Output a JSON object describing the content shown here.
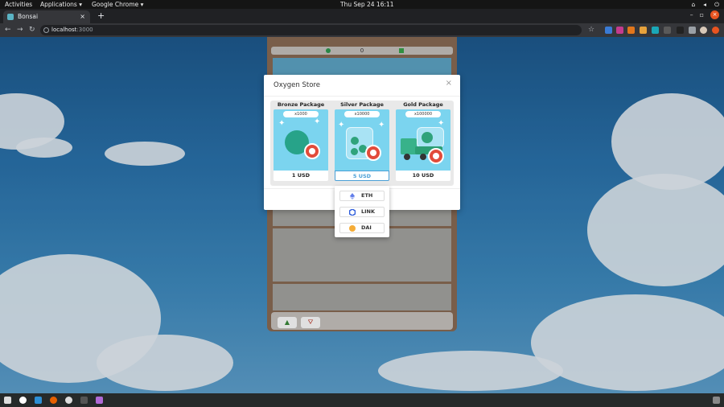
{
  "gnome": {
    "activities": "Activities",
    "applications": "Applications ▾",
    "app": "Google Chrome ▾",
    "clock": "Thu Sep 24  16:11"
  },
  "browser": {
    "tab_title": "Bonsai",
    "url_host": "localhost",
    "url_port": ":3000",
    "new_tab": "+"
  },
  "hud": {
    "count": "0"
  },
  "modal": {
    "title": "Oxygen Store",
    "close": "×",
    "packages": [
      {
        "name": "Bronze Package",
        "badge": "x1000",
        "price": "1 USD"
      },
      {
        "name": "Silver Package",
        "badge": "x10000",
        "price": "5 USD"
      },
      {
        "name": "Gold Package",
        "badge": "x100000",
        "price": "10 USD"
      }
    ]
  },
  "pay_options": [
    {
      "label": "ETH",
      "icon": "eth-icon",
      "color": "#627eea"
    },
    {
      "label": "LINK",
      "icon": "chainlink-icon",
      "color": "#2a5ada"
    },
    {
      "label": "DAI",
      "icon": "dai-icon",
      "color": "#f5ac37"
    }
  ],
  "colors": {
    "accent": "#4a9fd6",
    "card_bg": "#7bd4ef",
    "ubuntu_orange": "#e95420"
  }
}
